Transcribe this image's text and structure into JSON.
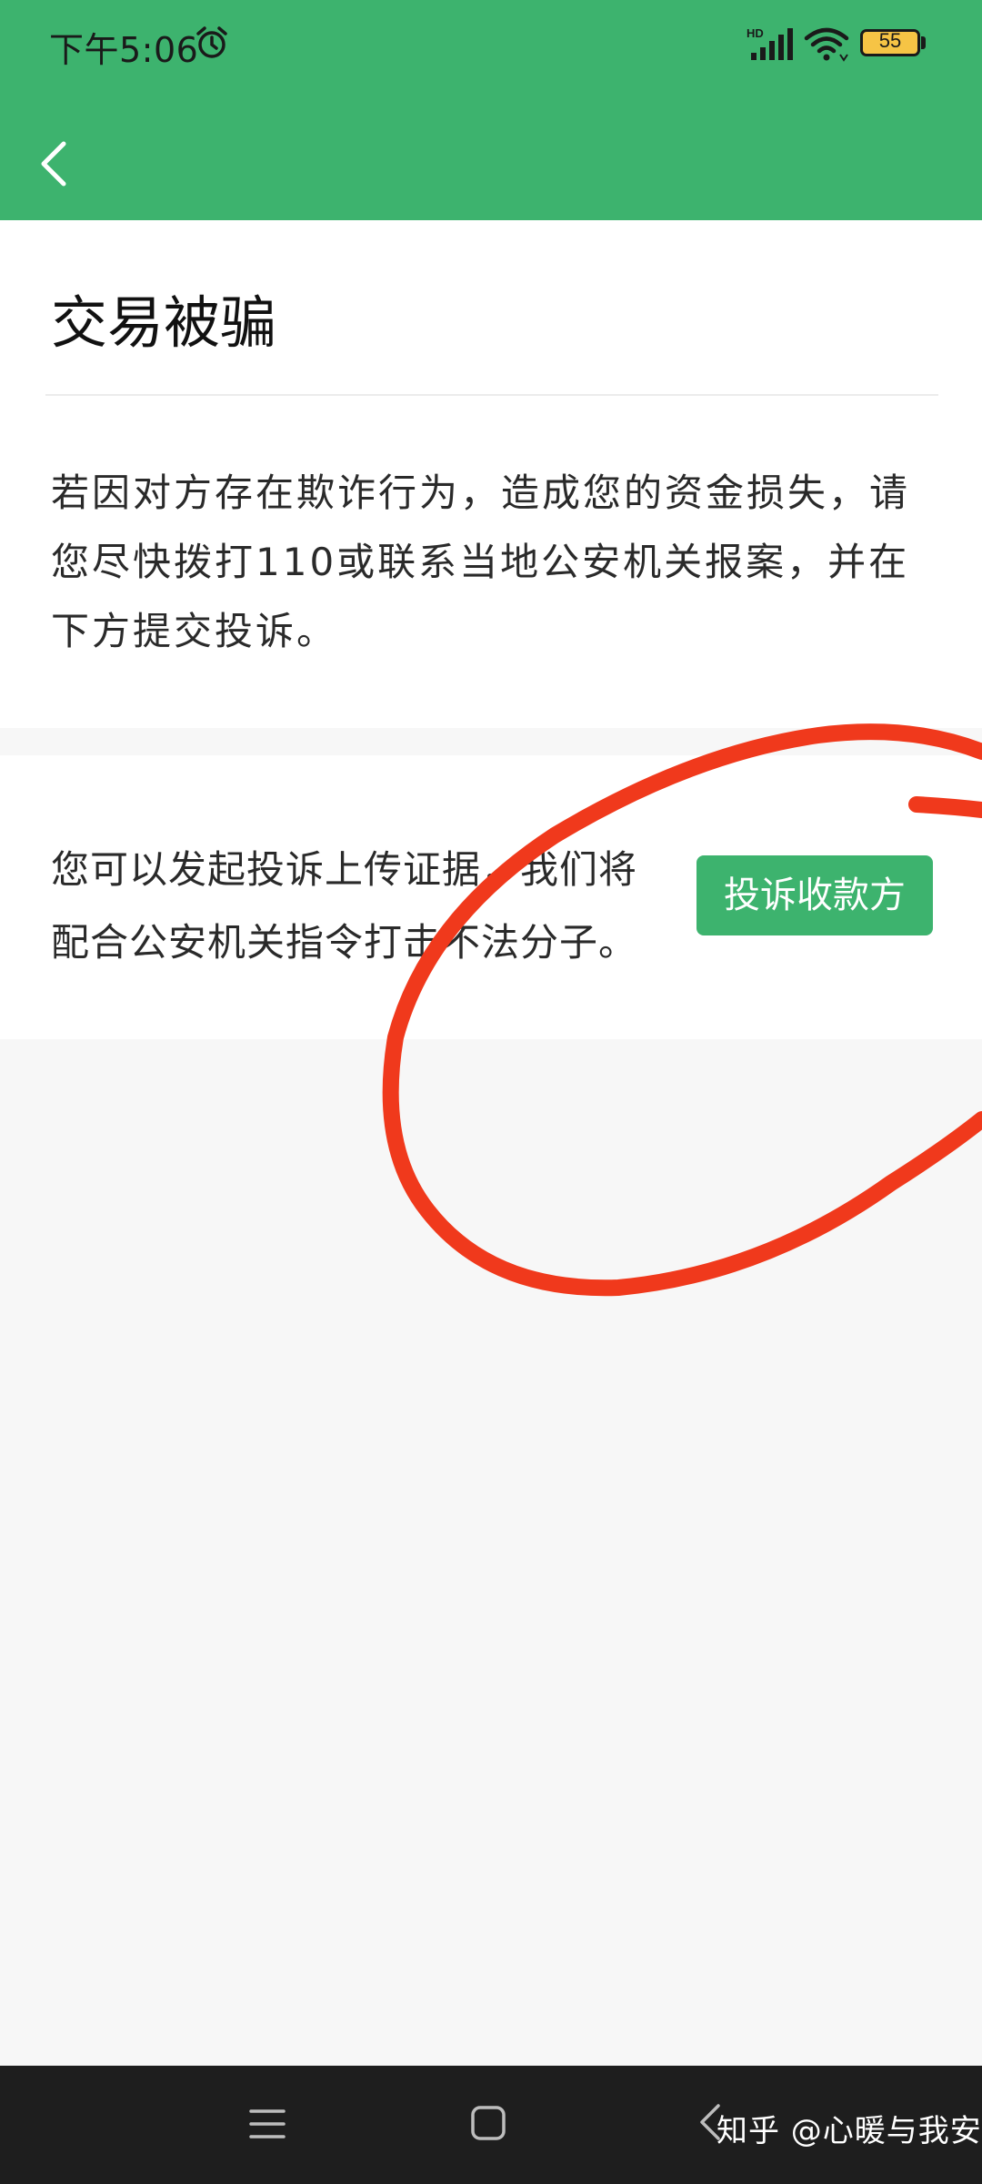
{
  "status_bar": {
    "time": "下午5:06",
    "network_badge": "HD",
    "battery_level": "55"
  },
  "icons": {
    "alarm": "alarm-clock-icon",
    "signal": "hd-signal-icon",
    "wifi": "wifi-icon",
    "back": "chevron-left-icon",
    "nav_menu": "menu-lines-icon",
    "nav_home": "square-home-icon",
    "nav_back": "chevron-left-icon"
  },
  "page": {
    "title": "交易被骗",
    "notice": "若因对方存在欺诈行为，造成您的资金损失，请您尽快拨打110或联系当地公安机关报案，并在下方提交投诉。",
    "complaint_desc": "您可以发起投诉上传证据，我们将配合公安机关指令打击不法分子。",
    "complain_button": "投诉收款方"
  },
  "watermark": "知乎 @心暖与我安",
  "colors": {
    "brand_green": "#3db36e",
    "annotation_red": "#f0391c",
    "nav_bar": "#1e1e1e",
    "battery": "#f6c445"
  }
}
